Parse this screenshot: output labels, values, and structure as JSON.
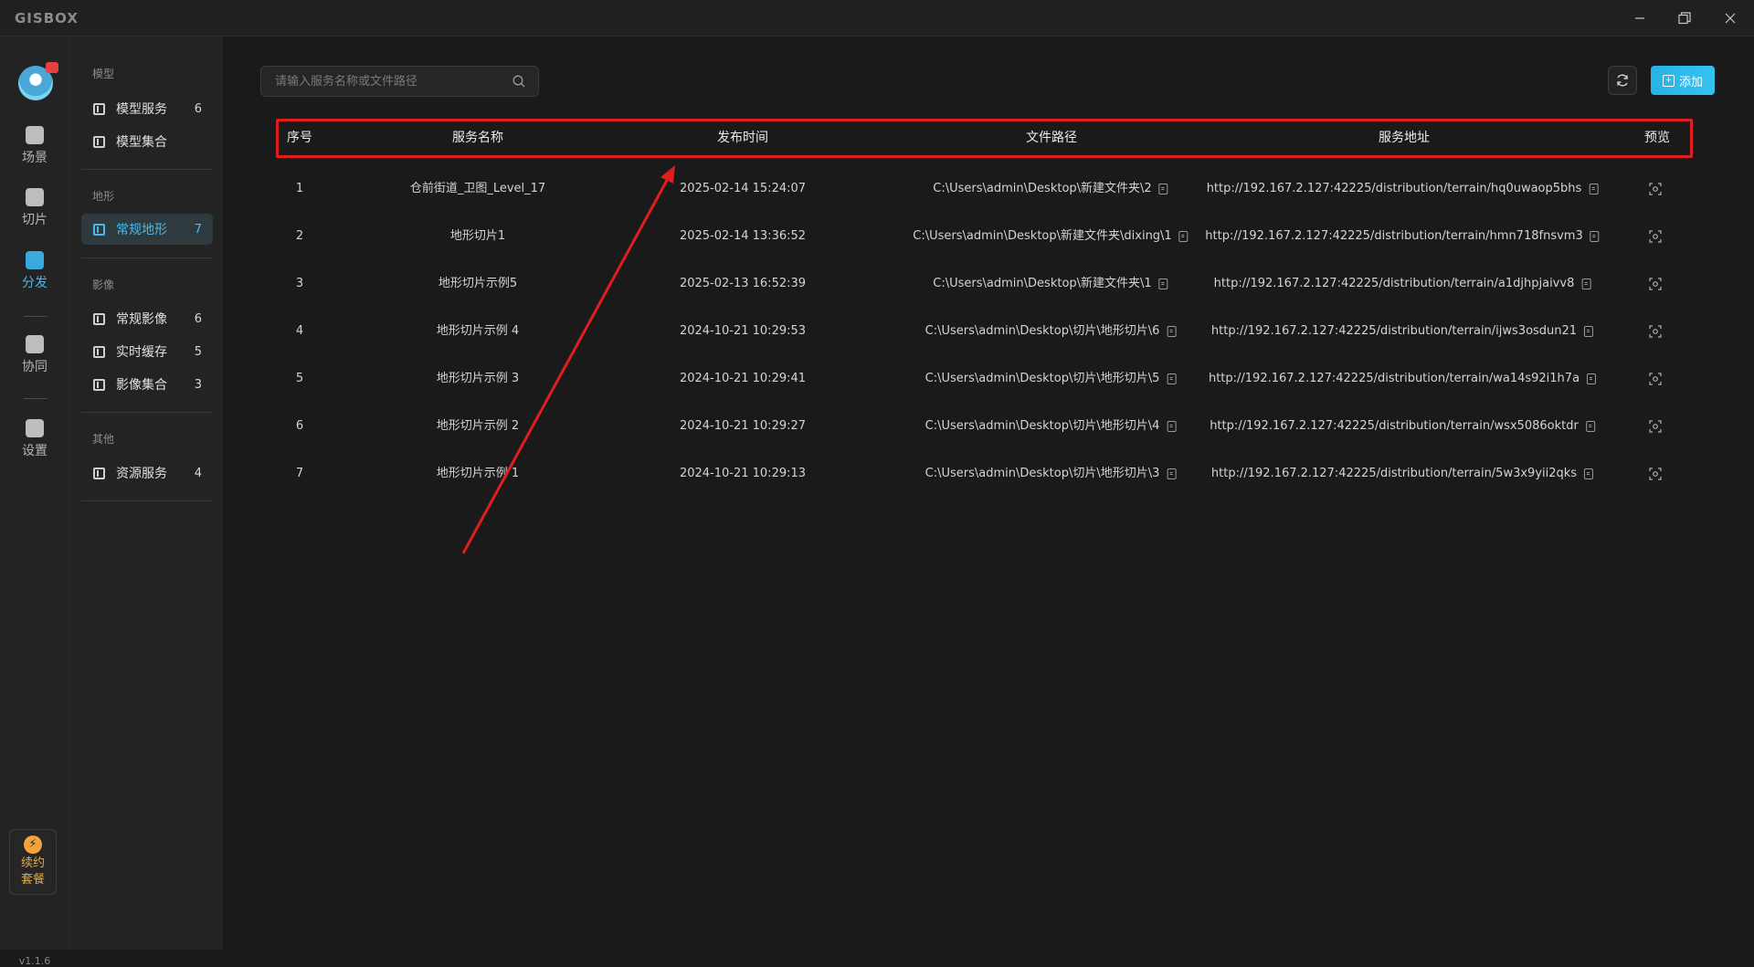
{
  "app": {
    "logo": "GISBOX",
    "version": "v1.1.6"
  },
  "rail": {
    "items": [
      {
        "label": "场景",
        "icon": "scene-icon"
      },
      {
        "label": "切片",
        "icon": "tile-icon"
      },
      {
        "label": "分发",
        "icon": "distribute-icon",
        "active": true
      },
      {
        "label": "协同",
        "icon": "collab-icon"
      },
      {
        "label": "设置",
        "icon": "settings-icon"
      }
    ],
    "renew_line1": "续约",
    "renew_line2": "套餐"
  },
  "sidepanel": {
    "group_model": "模型",
    "model_service": {
      "label": "模型服务",
      "count": "6"
    },
    "model_collection": {
      "label": "模型集合"
    },
    "group_terrain": "地形",
    "terrain_regular": {
      "label": "常规地形",
      "count": "7"
    },
    "group_imagery": "影像",
    "imagery_regular": {
      "label": "常规影像",
      "count": "6"
    },
    "imagery_cache": {
      "label": "实时缓存",
      "count": "5"
    },
    "imagery_collection": {
      "label": "影像集合",
      "count": "3"
    },
    "group_other": "其他",
    "resource_service": {
      "label": "资源服务",
      "count": "4"
    }
  },
  "toolbar": {
    "search_placeholder": "请输入服务名称或文件路径",
    "add_label": "添加"
  },
  "table": {
    "headers": {
      "index": "序号",
      "name": "服务名称",
      "time": "发布时间",
      "path": "文件路径",
      "url": "服务地址",
      "preview": "预览"
    },
    "rows": [
      {
        "index": "1",
        "name": "仓前街道_卫图_Level_17",
        "time": "2025-02-14 15:24:07",
        "path": "C:\\Users\\admin\\Desktop\\新建文件夹\\2",
        "url": "http://192.167.2.127:42225/distribution/terrain/hq0uwaop5bhs"
      },
      {
        "index": "2",
        "name": "地形切片1",
        "time": "2025-02-14 13:36:52",
        "path": "C:\\Users\\admin\\Desktop\\新建文件夹\\dixing\\1",
        "url": "http://192.167.2.127:42225/distribution/terrain/hmn718fnsvm3"
      },
      {
        "index": "3",
        "name": "地形切片示例5",
        "time": "2025-02-13 16:52:39",
        "path": "C:\\Users\\admin\\Desktop\\新建文件夹\\1",
        "url": "http://192.167.2.127:42225/distribution/terrain/a1djhpjaivv8"
      },
      {
        "index": "4",
        "name": "地形切片示例 4",
        "time": "2024-10-21 10:29:53",
        "path": "C:\\Users\\admin\\Desktop\\切片\\地形切片\\6",
        "url": "http://192.167.2.127:42225/distribution/terrain/ijws3osdun21"
      },
      {
        "index": "5",
        "name": "地形切片示例 3",
        "time": "2024-10-21 10:29:41",
        "path": "C:\\Users\\admin\\Desktop\\切片\\地形切片\\5",
        "url": "http://192.167.2.127:42225/distribution/terrain/wa14s92i1h7a"
      },
      {
        "index": "6",
        "name": "地形切片示例 2",
        "time": "2024-10-21 10:29:27",
        "path": "C:\\Users\\admin\\Desktop\\切片\\地形切片\\4",
        "url": "http://192.167.2.127:42225/distribution/terrain/wsx5086oktdr"
      },
      {
        "index": "7",
        "name": "地形切片示例 1",
        "time": "2024-10-21 10:29:13",
        "path": "C:\\Users\\admin\\Desktop\\切片\\地形切片\\3",
        "url": "http://192.167.2.127:42225/distribution/terrain/5w3x9yii2qks"
      }
    ]
  },
  "colors": {
    "accent": "#35c2f2",
    "highlight_box": "#e01e1e",
    "annotation_arrow": "#e01e1e"
  }
}
